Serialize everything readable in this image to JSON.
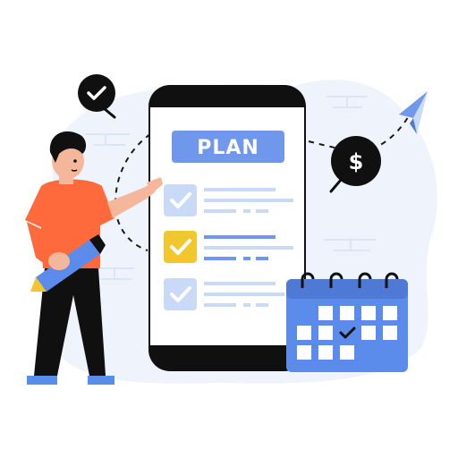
{
  "phone": {
    "header_label": "PLAN",
    "tasks": [
      {
        "state": "done"
      },
      {
        "state": "highlighted"
      },
      {
        "state": "done"
      }
    ]
  },
  "coin": {
    "symbol": "$"
  },
  "colors": {
    "blob": "#EEF3FC",
    "phone_body": "#101010",
    "screen": "#FFFFFF",
    "accent_blue": "#6F97EC",
    "light_blue": "#C9DAF8",
    "yellow": "#F2C72E",
    "shirt": "#FF6A3D",
    "skin": "#F4B79C",
    "ink": "#0D0D0D",
    "shoe": "#5B8CEC"
  },
  "icons": [
    "check-bubble-icon",
    "dollar-coin-icon",
    "paper-plane-icon",
    "calendar-icon",
    "pencil-icon",
    "checkbox-icon"
  ]
}
